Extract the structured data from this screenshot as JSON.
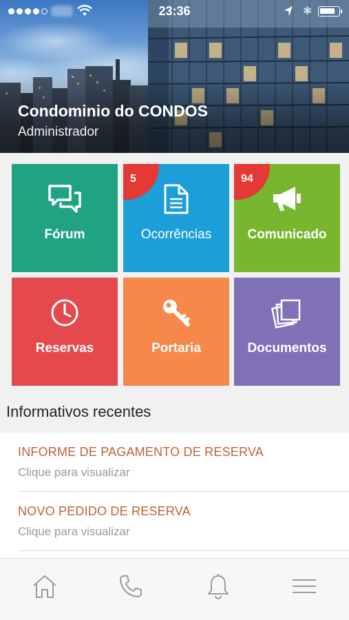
{
  "status_bar": {
    "time": "23:36",
    "signal_dots_filled": 4,
    "signal_dots_total": 5,
    "battery_level": 0.85
  },
  "header": {
    "title": "Condominio do CONDOS",
    "subtitle": "Administrador"
  },
  "tiles": [
    {
      "label": "Fórum",
      "color": "#20a382",
      "icon": "chat-bubbles-icon",
      "badge": null
    },
    {
      "label": "Ocorrências",
      "color": "#1c9fd8",
      "icon": "document-icon",
      "badge": "5"
    },
    {
      "label": "Comunicado",
      "color": "#78b62f",
      "icon": "megaphone-icon",
      "badge": "94"
    },
    {
      "label": "Reservas",
      "color": "#e5484d",
      "icon": "clock-icon",
      "badge": null
    },
    {
      "label": "Portaria",
      "color": "#f5884a",
      "icon": "key-icon",
      "badge": null
    },
    {
      "label": "Documentos",
      "color": "#7f70b8",
      "icon": "stacked-documents-icon",
      "badge": null
    }
  ],
  "recent": {
    "title": "Informativos recentes",
    "items": [
      {
        "title": "INFORME DE PAGAMENTO DE RESERVA",
        "subtitle": "Clique para visualizar"
      },
      {
        "title": "NOVO PEDIDO DE RESERVA",
        "subtitle": "Clique para visualizar"
      }
    ]
  },
  "tabbar": {
    "items": [
      "home-icon",
      "phone-icon",
      "bell-icon",
      "menu-icon"
    ],
    "accent": "#9b9b9b"
  }
}
